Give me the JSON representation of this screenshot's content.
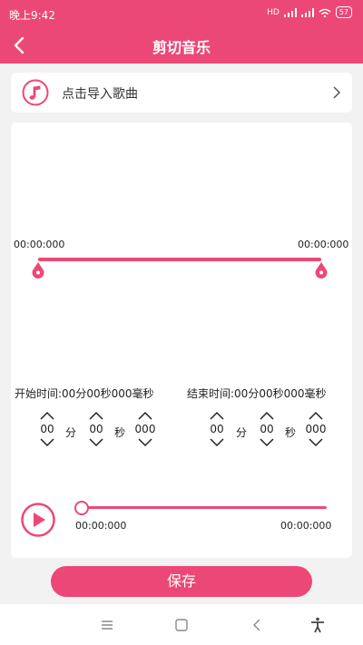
{
  "status_bar": {
    "time": "晚上9:42",
    "network": "HD",
    "battery": "57"
  },
  "title_bar": {
    "title": "剪切音乐",
    "back_icon": "chevron-left-icon"
  },
  "import": {
    "label": "点击导入歌曲",
    "icon": "music-note-icon"
  },
  "waveform": {
    "start_time": "00:00:000",
    "end_time": "00:00:000"
  },
  "start": {
    "label": "开始时间:00分00秒000毫秒",
    "minutes": "00",
    "minutes_unit": "分",
    "seconds": "00",
    "seconds_unit": "秒",
    "millis": "000"
  },
  "end": {
    "label": "结束时间:00分00秒000毫秒",
    "minutes": "00",
    "minutes_unit": "分",
    "seconds": "00",
    "seconds_unit": "秒",
    "millis": "000"
  },
  "player": {
    "current_time": "00:00:000",
    "total_time": "00:00:000",
    "progress": 0
  },
  "save_label": "保存",
  "colors": {
    "accent": "#ec4877",
    "background": "#f2f2f2",
    "card": "#ffffff"
  }
}
